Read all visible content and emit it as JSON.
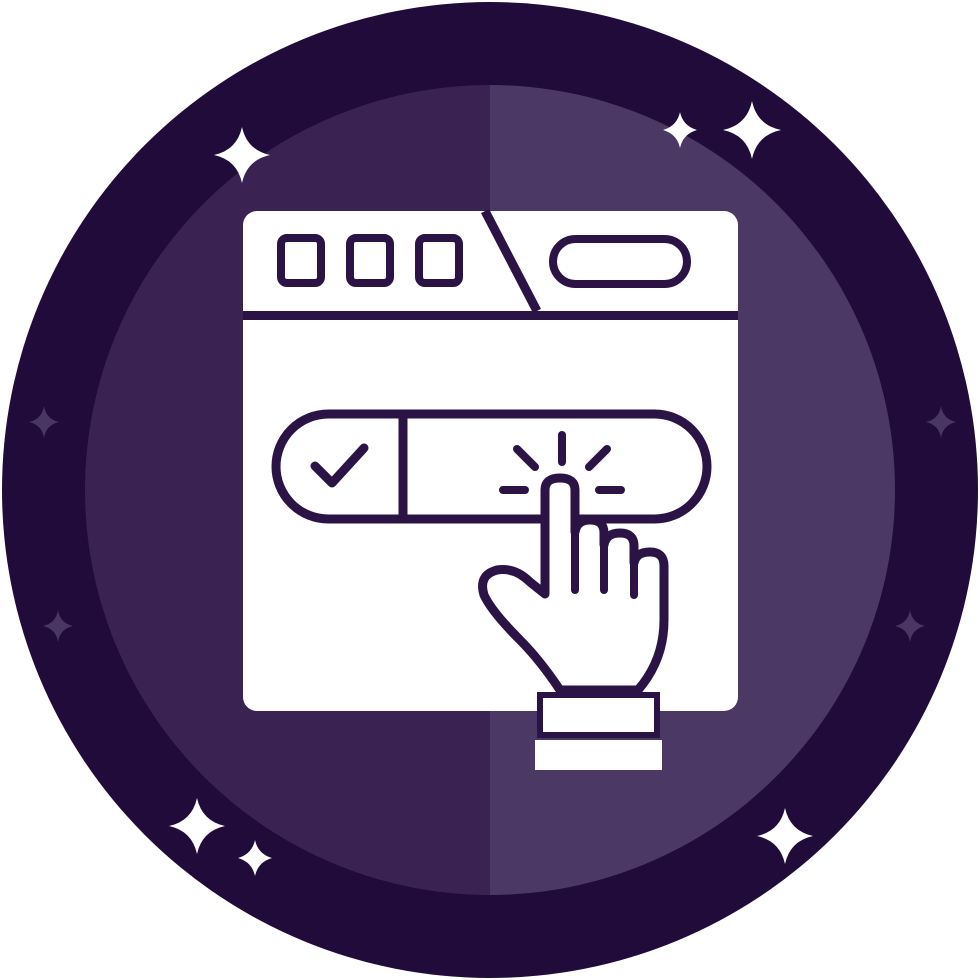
{
  "badge": {
    "icon": "browser-click-toggle-icon",
    "colors": {
      "outer_ring": "#210b3b",
      "inner_left": "#3a2352",
      "inner_right": "#4c3864",
      "glyph": "#ffffff",
      "sparkle_bright": "#ffffff",
      "sparkle_dim": "#4a3662"
    }
  },
  "toggle": {
    "state": "on",
    "icon": "check-icon"
  },
  "browser": {
    "tab_dots": 3,
    "icons": [
      "browser-window-icon",
      "address-bar-icon"
    ]
  },
  "hand": {
    "icon": "pointing-hand-icon",
    "action": "click"
  }
}
